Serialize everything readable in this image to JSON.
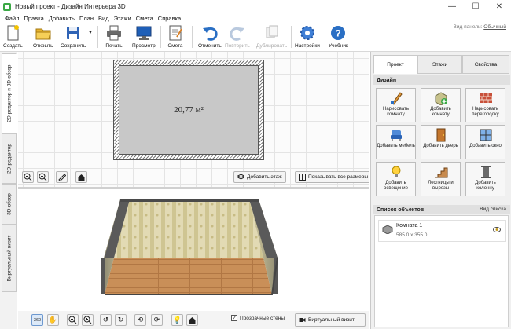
{
  "window": {
    "title": "Новый проект - Дизайн Интерьера 3D",
    "controls": [
      "—",
      "☐",
      "✕"
    ]
  },
  "menu": [
    "Файл",
    "Правка",
    "Добавить",
    "План",
    "Вид",
    "Этажи",
    "Смета",
    "Справка"
  ],
  "toolbar": {
    "create": "Создать",
    "open": "Открыть",
    "save": "Сохранить",
    "print": "Печать",
    "preview": "Просмотр",
    "estimate": "Смета",
    "undo": "Отменить",
    "redo": "Повторить",
    "duplicate": "Дублировать",
    "settings": "Настройки",
    "tutorial": "Учебник",
    "panel_view_label": "Вид панели:",
    "panel_view_value": "Обычный"
  },
  "left_tabs": [
    "2D-редактор и 3D-обзор",
    "2D-редактор",
    "3D-обзор",
    "Виртуальный визит"
  ],
  "plan2d": {
    "room_area": "20,77 м²",
    "add_floor": "Добавить этаж",
    "show_all_sizes": "Показывать все размеры"
  },
  "view3d": {
    "transparent_walls_label": "Прозрачные стены",
    "transparent_walls_checked": true,
    "virtual_visit": "Виртуальный визит"
  },
  "right_panel": {
    "tabs": [
      "Проект",
      "Этажи",
      "Свойства"
    ],
    "active_tab": "Проект",
    "design_header": "Дизайн",
    "design_buttons": [
      "Нарисовать комнату",
      "Добавить комнату",
      "Нарисовать перегородку",
      "Добавить мебель",
      "Добавить дверь",
      "Добавить окно",
      "Добавить освещение",
      "Лестницы и вырезы",
      "Добавить колонну"
    ],
    "objects_header": "Список объектов",
    "objects_view": "Вид списка",
    "objects": [
      {
        "name": "Комната 1",
        "size": "585.0 x 355.0"
      }
    ]
  },
  "colors": {
    "accent_blue": "#2a6fc4",
    "room_floor_2d": "#c8c8c8",
    "wood_floor": "#c48a52",
    "wallpaper": "#d8cfa6"
  }
}
